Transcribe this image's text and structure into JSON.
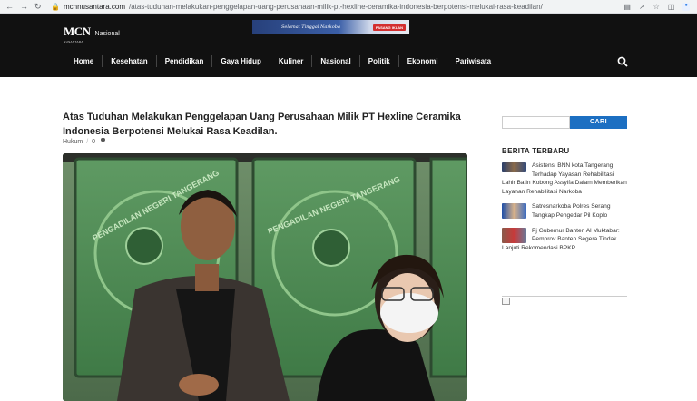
{
  "browser": {
    "url_host": "mcnnusantara.com",
    "url_path": "/atas-tuduhan-melakukan-penggelapan-uang-perusahaan-milik-pt-hexline-ceramika-indonesia-berpotensi-melukai-rasa-keadilan/"
  },
  "site": {
    "logo_main": "MCN",
    "logo_sub": "NUSANTARA",
    "logo_section": "Nasional",
    "banner_text": "Selamat Tinggal Narkoba",
    "banner_badge": "PASANG IKLAN"
  },
  "nav": {
    "items": [
      "Home",
      "Kesehatan",
      "Pendidikan",
      "Gaya Hidup",
      "Kuliner",
      "Nasional",
      "Politik",
      "Ekonomi",
      "Pariwisata"
    ]
  },
  "article": {
    "title": "Atas Tuduhan Melakukan Penggelapan Uang Perusahaan Milik PT Hexline Ceramika Indonesia Berpotensi Melukai Rasa Keadilan.",
    "category": "Hukum",
    "comments": "0",
    "photo_sign_left": "PENGADILAN NEGERI TANGERANG",
    "photo_sign_right": "PENGADILAN NEGERI TANGERANG"
  },
  "sidebar": {
    "search_button": "CARI",
    "heading": "BERITA TERBARU",
    "news": [
      "Asistensi BNN kota Tangerang Terhadap Yayasan Rehabilitasi Lahir Batin Kobong Assyifa Dalam Memberikan Layanan Rehabilitasi Narkoba",
      "Satresnarkoba Polres Serang Tangkap Pengedar Pil Koplo",
      "Pj Gubernur Banten Al Muktabar: Pemprov Banten Segera Tindak Lanjuti Rekomendasi BPKP"
    ]
  }
}
